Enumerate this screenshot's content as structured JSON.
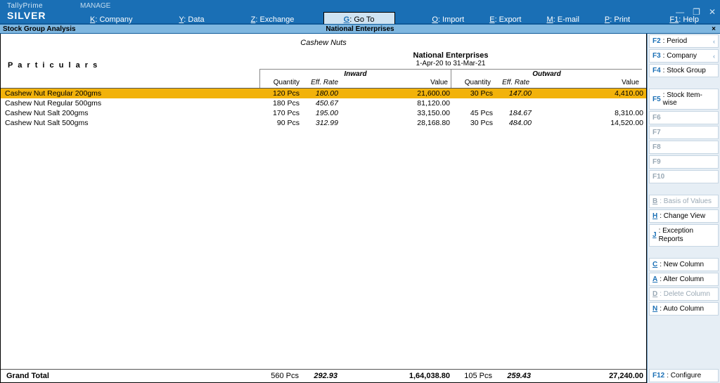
{
  "brand": {
    "top": "TallyPrime",
    "bottom": "SILVER",
    "manage": "MANAGE"
  },
  "top_menu": {
    "company": {
      "key": "K",
      "label": ": Company"
    },
    "data": {
      "key": "Y",
      "label": ": Data"
    },
    "exchange": {
      "key": "Z",
      "label": ": Exchange"
    },
    "goto": {
      "key": "G",
      "label": ": Go To"
    },
    "import": {
      "key": "O",
      "label": ": Import"
    },
    "export": {
      "key": "E",
      "label": ": Export"
    },
    "email": {
      "key": "M",
      "label": ": E-mail"
    },
    "print": {
      "key": "P",
      "label": ": Print"
    },
    "help": {
      "key": "F1",
      "label": ": Help"
    }
  },
  "subheader": {
    "left": "Stock Group Analysis",
    "center": "National Enterprises",
    "close": "×"
  },
  "report": {
    "stock_group": "Cashew Nuts",
    "company": "National Enterprises",
    "period": "1-Apr-20 to 31-Mar-21",
    "particulars_label": "P a r t i c u l a r s",
    "inward_label": "Inward",
    "outward_label": "Outward",
    "col_qty": "Quantity",
    "col_rate": "Eff. Rate",
    "col_val": "Value"
  },
  "rows": [
    {
      "name": "Cashew Nut Regular 200gms",
      "in_qty": "120 Pcs",
      "in_rate": "180.00",
      "in_val": "21,600.00",
      "out_qty": "30 Pcs",
      "out_rate": "147.00",
      "out_val": "4,410.00"
    },
    {
      "name": "Cashew Nut Regular 500gms",
      "in_qty": "180 Pcs",
      "in_rate": "450.67",
      "in_val": "81,120.00",
      "out_qty": "",
      "out_rate": "",
      "out_val": ""
    },
    {
      "name": "Cashew Nut Salt 200gms",
      "in_qty": "170 Pcs",
      "in_rate": "195.00",
      "in_val": "33,150.00",
      "out_qty": "45 Pcs",
      "out_rate": "184.67",
      "out_val": "8,310.00"
    },
    {
      "name": "Cashew Nut Salt 500gms",
      "in_qty": "90 Pcs",
      "in_rate": "312.99",
      "in_val": "28,168.80",
      "out_qty": "30 Pcs",
      "out_rate": "484.00",
      "out_val": "14,520.00"
    }
  ],
  "totals": {
    "label": "Grand Total",
    "in_qty": "560 Pcs",
    "in_rate": "292.93",
    "in_val": "1,64,038.80",
    "out_qty": "105 Pcs",
    "out_rate": "259.43",
    "out_val": "27,240.00"
  },
  "side": {
    "period": {
      "key": "F2",
      "label": ": Period"
    },
    "company": {
      "key": "F3",
      "label": ": Company"
    },
    "stockgrp": {
      "key": "F4",
      "label": ": Stock Group"
    },
    "itemwise": {
      "key": "F5",
      "label": ": Stock Item-wise"
    },
    "f6": "F6",
    "f7": "F7",
    "f8": "F8",
    "f9": "F9",
    "f10": "F10",
    "basis": {
      "key": "B",
      "label": ": Basis of Values"
    },
    "changeview": {
      "key": "H",
      "label": ": Change View"
    },
    "exception": {
      "key": "J",
      "label": ": Exception Reports"
    },
    "newcol": {
      "key": "C",
      "label": ": New Column"
    },
    "altercol": {
      "key": "A",
      "label": ": Alter Column"
    },
    "delcol": {
      "key": "D",
      "label": ": Delete Column"
    },
    "autocol": {
      "key": "N",
      "label": ": Auto Column"
    },
    "configure": {
      "key": "F12",
      "label": ": Configure"
    }
  }
}
